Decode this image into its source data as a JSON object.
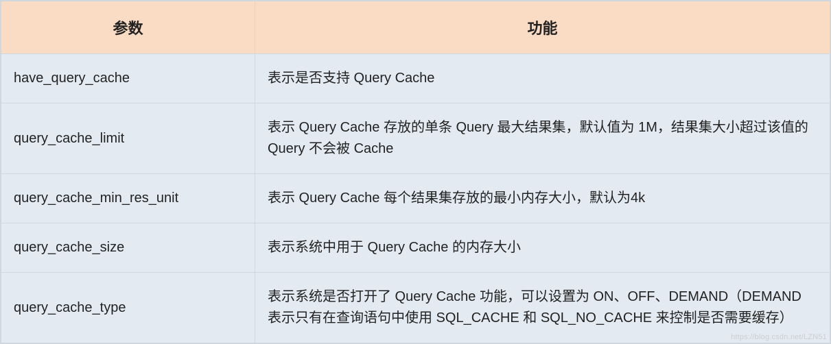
{
  "chart_data": {
    "type": "table",
    "headers": [
      "参数",
      "功能"
    ],
    "rows": [
      {
        "param": "have_query_cache",
        "func": "表示是否支持 Query Cache"
      },
      {
        "param": "query_cache_limit",
        "func": "表示 Query Cache 存放的单条 Query 最大结果集，默认值为 1M，结果集大小超过该值的 Query 不会被 Cache"
      },
      {
        "param": "query_cache_min_res_unit",
        "func": "表示 Query Cache 每个结果集存放的最小内存大小，默认为4k"
      },
      {
        "param": "query_cache_size",
        "func": "表示系统中用于 Query Cache 的内存大小"
      },
      {
        "param": "query_cache_type",
        "func": "表示系统是否打开了 Query Cache 功能，可以设置为 ON、OFF、DEMAND（DEMAND 表示只有在查询语句中使用 SQL_CACHE 和 SQL_NO_CACHE 来控制是否需要缓存）"
      }
    ]
  },
  "watermark": "https://blog.csdn.net/LZN51"
}
